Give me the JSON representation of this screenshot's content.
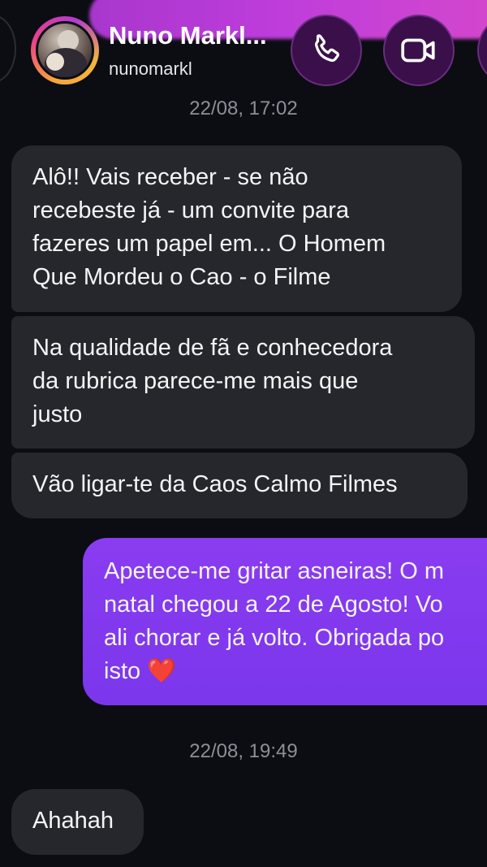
{
  "header": {
    "contact_name": "Nuno Markl...",
    "contact_handle": "nunomarkl",
    "icons": {
      "call": "phone-icon",
      "video": "video-camera-icon",
      "back": "back-chevron-icon"
    },
    "accent_color": "#c840e6"
  },
  "thread": {
    "timestamp_1": "22/08, 17:02",
    "timestamp_2": "22/08, 19:49",
    "messages": [
      {
        "direction": "incoming",
        "lines": [
          "Alô!! Vais receber - se não",
          "recebeste já - um convite para",
          "fazeres um papel em... O Homem",
          "Que Mordeu o Cao - o Filme"
        ]
      },
      {
        "direction": "incoming",
        "lines": [
          "Na qualidade de fã e conhecedora",
          "da rubrica parece-me mais que",
          "justo"
        ]
      },
      {
        "direction": "incoming",
        "lines": [
          "Vão ligar-te da Caos Calmo Filmes"
        ]
      },
      {
        "direction": "outgoing",
        "lines": [
          "Apetece-me gritar asneiras! O m",
          "natal chegou a 22 de Agosto! Vo",
          "ali chorar e já volto. Obrigada po",
          "isto"
        ],
        "emoji": "❤️"
      },
      {
        "direction": "incoming",
        "lines": [
          "Ahahah"
        ]
      }
    ],
    "colors": {
      "incoming_bubble": "#26272d",
      "outgoing_bubble": "#7b36ec",
      "background": "#0b0d12"
    }
  }
}
